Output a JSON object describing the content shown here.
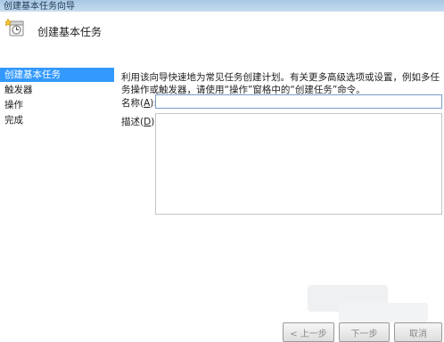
{
  "window": {
    "title": "创建基本任务向导"
  },
  "header": {
    "title": "创建基本任务",
    "icon": "task-wizard-icon"
  },
  "nav": {
    "items": [
      {
        "label": "创建基本任务",
        "selected": true
      },
      {
        "label": "触发器",
        "selected": false
      },
      {
        "label": "操作",
        "selected": false
      },
      {
        "label": "完成",
        "selected": false
      }
    ]
  },
  "content": {
    "description": "利用该向导快速地为常见任务创建计划。有关更多高级选项或设置，例如多任务操作或触发器，请使用“操作”窗格中的“创建任务”命令。",
    "name_label_prefix": "名称(",
    "name_label_key": "A",
    "name_label_suffix": "):",
    "name_value": "",
    "desc_label_prefix": "描述(",
    "desc_label_key": "D",
    "desc_label_suffix": "):",
    "desc_value": ""
  },
  "buttons": {
    "back": "< 上一步",
    "next": "下一步",
    "cancel": "取消"
  },
  "colors": {
    "selected_bg": "#3399ff",
    "titlebar": "#b9d3ea",
    "input_border": "#7a9cc8"
  }
}
